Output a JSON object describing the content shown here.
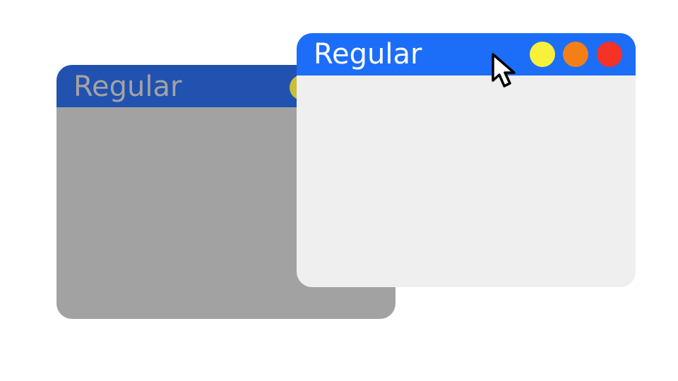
{
  "windows": {
    "back": {
      "title": "Regular",
      "state": "inactive"
    },
    "front": {
      "title": "Regular",
      "state": "active"
    }
  },
  "controls": [
    {
      "name": "yellow",
      "color": "#f8f03a"
    },
    {
      "name": "orange",
      "color": "#f57f17"
    },
    {
      "name": "red",
      "color": "#f43225"
    }
  ],
  "colors": {
    "active_titlebar": "#1c6ef8",
    "inactive_titlebar": "#2152b0",
    "active_body": "#efefef",
    "inactive_body": "#a2a2a2",
    "inactive_dot": "#c8c03a"
  },
  "cursor_icon": "arrow-pointer"
}
